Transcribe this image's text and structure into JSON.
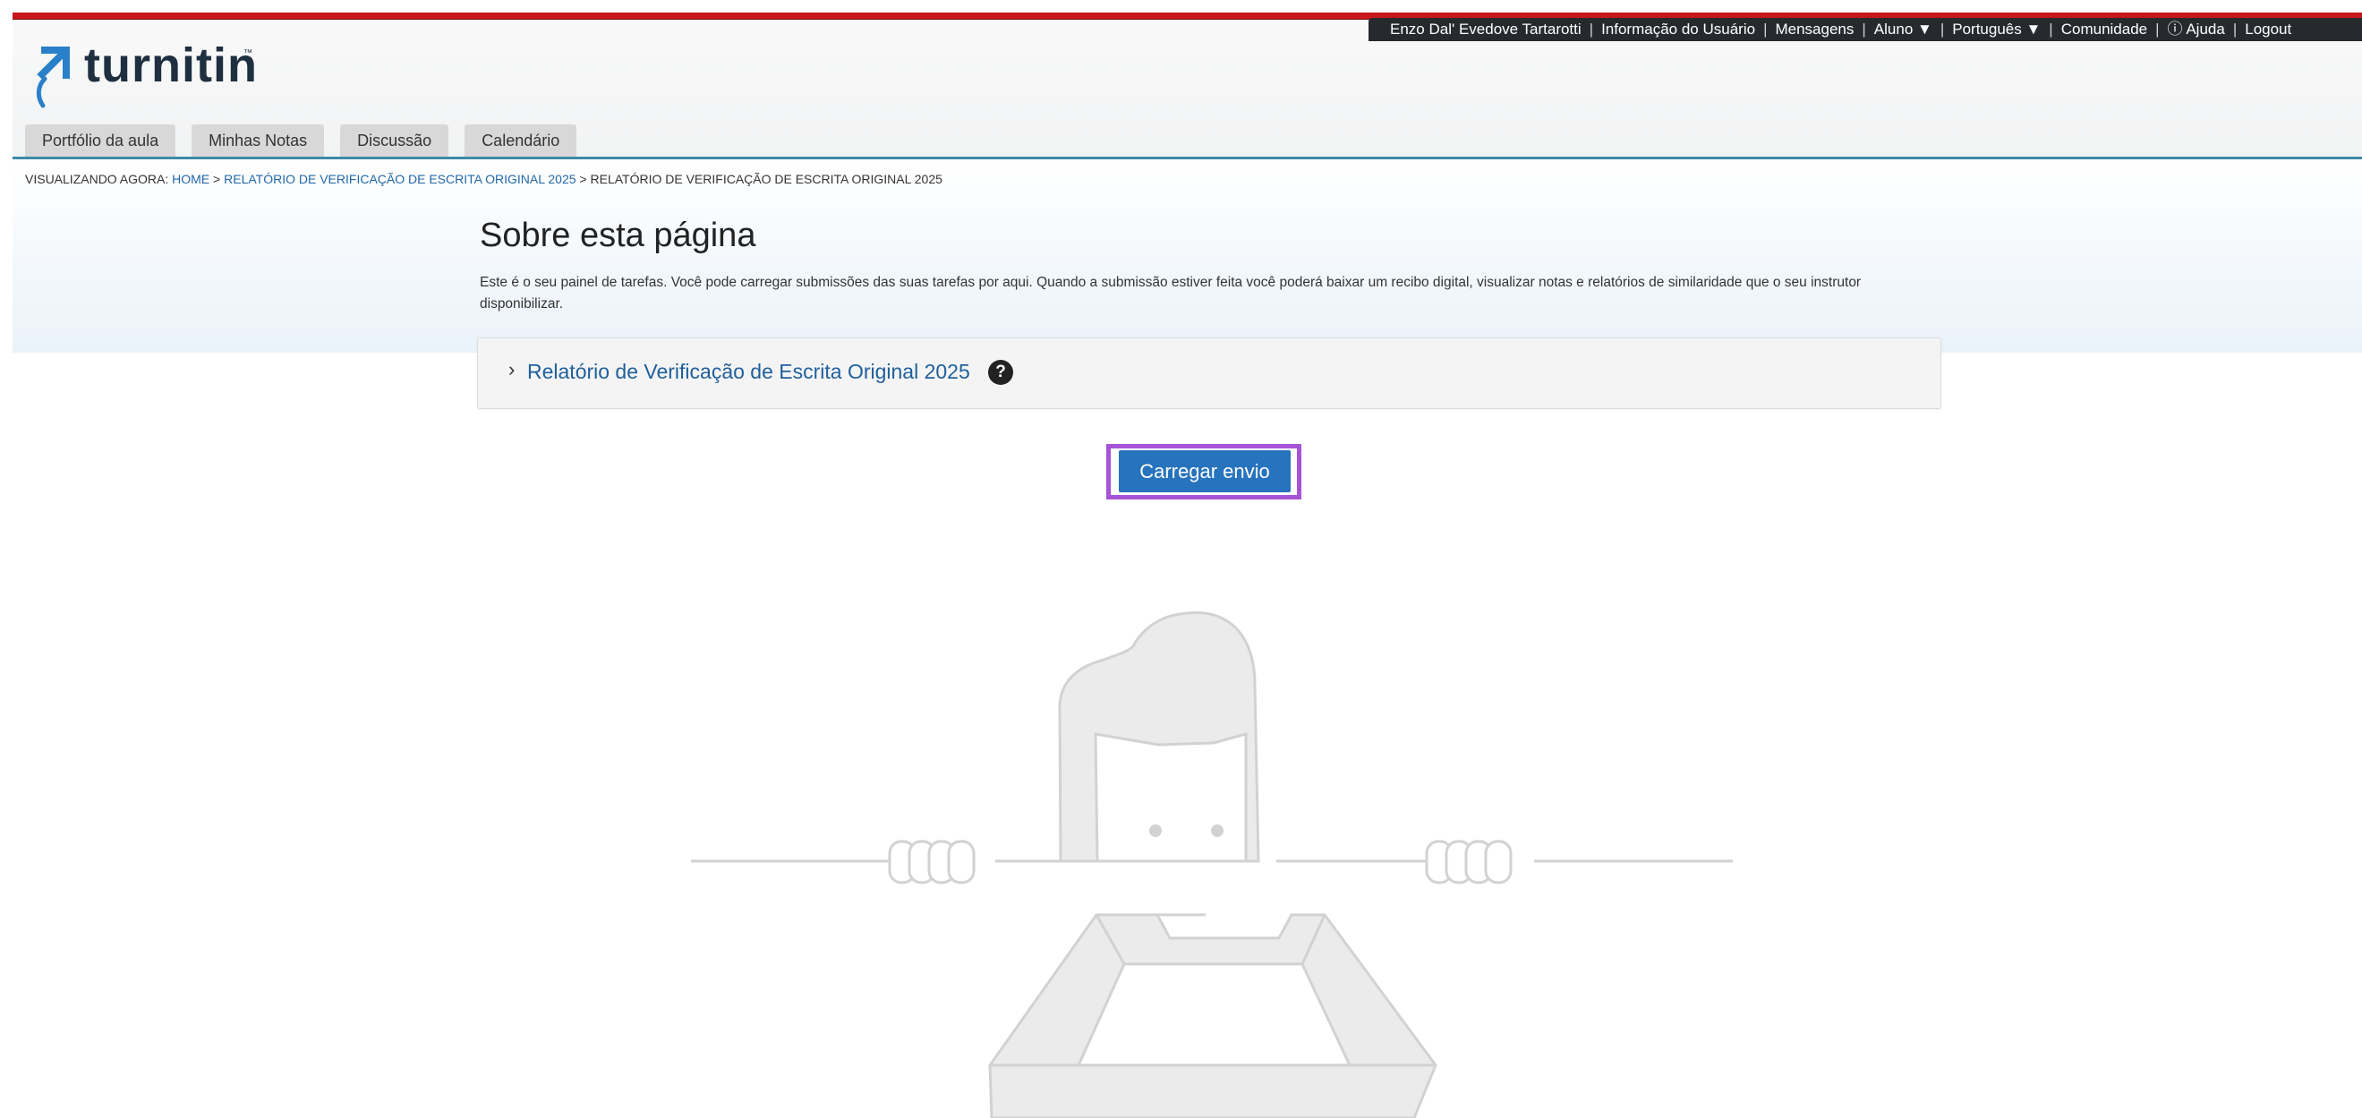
{
  "brand": {
    "name": "turnitin",
    "trademark": "™"
  },
  "usernav": {
    "user_name": "Enzo Dal' Evedove Tartarotti",
    "user_info": "Informação do Usuário",
    "messages": "Mensagens",
    "role": "Aluno ▼",
    "language": "Português ▼",
    "community": "Comunidade",
    "help": "ⓘ Ajuda",
    "logout": "Logout"
  },
  "tabs": [
    "Portfólio da aula",
    "Minhas Notas",
    "Discussão",
    "Calendário"
  ],
  "breadcrumb": {
    "prefix": "VISUALIZANDO AGORA:",
    "home": "HOME",
    "class_link": "RELATÓRIO DE VERIFICAÇÃO DE ESCRITA ORIGINAL 2025",
    "current": "RELATÓRIO DE VERIFICAÇÃO DE ESCRITA ORIGINAL 2025",
    "separator": ">"
  },
  "main": {
    "title": "Sobre esta página",
    "intro": "Este é o seu painel de tarefas. Você pode carregar submissões das suas tarefas por aqui. Quando a submissão estiver feita você poderá baixar um recibo digital, visualizar notas e relatórios de similaridade que o seu instrutor disponibilizar.",
    "assignment_title": "Relatório de Verificação de Escrita Original 2025",
    "expand_icon": "chevron-right-icon",
    "help_icon": "?",
    "upload_button": "Carregar envio"
  },
  "colors": {
    "top_bar": "#c8171c",
    "nav_bg": "#262a2f",
    "link": "#2167a8",
    "button": "#2773be",
    "highlight": "#a653d6"
  }
}
